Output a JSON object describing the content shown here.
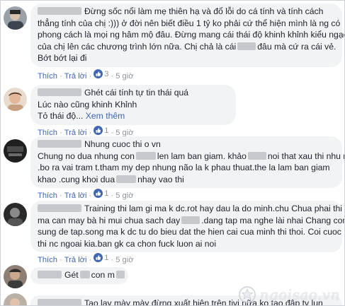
{
  "colors": {
    "bubble_bg": "#f2f3f5",
    "link": "#4267b2",
    "meta": "#90949c",
    "text": "#1d2129"
  },
  "actions": {
    "like": "Thích",
    "reply": "Trả lời",
    "dot": "·"
  },
  "comments": [
    {
      "lines": [
        "Đừng sốc nổi làm mẹ thiên hạ và đổ lỗi do cá tính và tính cách",
        "thẳng tính của chị :))) ở đời nên biết điều 1 tỷ ko phải cứ thể hiện mình là ng có",
        "phong cách là mọi ng hâm mộ đâu. Đừng mang cái thái độ khinh khỉnh kiểu ngạo",
        "của chị lên các chương trình lớn nữa. Chị chả là cái",
        "đâu mà cứ ra cái vẻ.",
        "Bớt bớt lại đi"
      ],
      "reactions": "3",
      "time": "5 giờ"
    },
    {
      "lines": [
        "Ghét cái tính tự tin thái quá",
        "Lúc nào cũng khinh Khỉnh",
        "Tỏ thái độ..."
      ],
      "see_more": "Xem thêm",
      "reactions": "1",
      "time": "5 giờ"
    },
    {
      "lines": [
        "Nhung cuoc thi o vn",
        "Chung no dua nhung con",
        "len lam ban giam. khảo",
        "noi that xau thi nhu ma",
        ".bo ra vai tram t.tham my dep nhung não la k phau thuat.the la lam ban giam",
        "khao .cung khoi dua",
        "nhay vao thi"
      ],
      "reactions": "1",
      "time": "5 giờ"
    },
    {
      "lines": [
        "Training thi lam gi ma k dc.rot hay dau la do minh.chu Chua phai thi",
        "ma can may bà hi mui chua sach day",
        ".dang tap ma nghe lài nhai Chang con",
        "sung de tap.song ma k dc tu do bieu dat the hien cai cua minh thi thoi. Coi cuoc",
        "thi nc ngoai kia.ban gk ca chon fuck luon ai noi"
      ],
      "reactions": "1",
      "time": "5 giờ"
    },
    {
      "lines": [
        "Gét",
        "con m"
      ]
    },
    {
      "lines": [
        "Tao lạy mày mày đừng xuất hiện trên tivi nữa ko tao đập tv lun"
      ]
    }
  ],
  "watermark": {
    "text": "ngoisao.vn",
    "icon": "star-logo-icon"
  }
}
